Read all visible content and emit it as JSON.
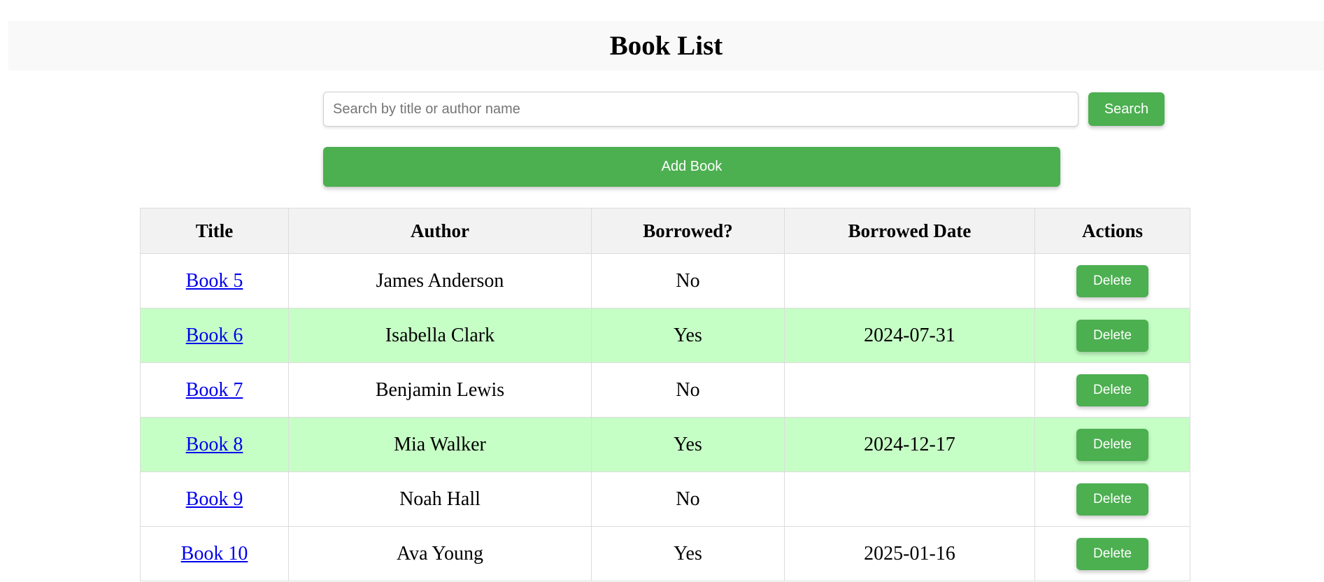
{
  "header": {
    "title": "Book List"
  },
  "search": {
    "placeholder": "Search by title or author name",
    "value": "",
    "button_label": "Search"
  },
  "actions": {
    "add_label": "Add Book"
  },
  "table": {
    "columns": [
      "Title",
      "Author",
      "Borrowed?",
      "Borrowed Date",
      "Actions"
    ],
    "delete_label": "Delete",
    "rows": [
      {
        "title": "Book 5",
        "author": "James Anderson",
        "borrowed": "No",
        "borrowed_date": ""
      },
      {
        "title": "Book 6",
        "author": "Isabella Clark",
        "borrowed": "Yes",
        "borrowed_date": "2024-07-31"
      },
      {
        "title": "Book 7",
        "author": "Benjamin Lewis",
        "borrowed": "No",
        "borrowed_date": ""
      },
      {
        "title": "Book 8",
        "author": "Mia Walker",
        "borrowed": "Yes",
        "borrowed_date": "2024-12-17"
      },
      {
        "title": "Book 9",
        "author": "Noah Hall",
        "borrowed": "No",
        "borrowed_date": ""
      },
      {
        "title": "Book 10",
        "author": "Ava Young",
        "borrowed": "Yes",
        "borrowed_date": "2025-01-16"
      }
    ]
  },
  "colors": {
    "accent": "#4caf50",
    "borrowed_row": "#c6ffc6",
    "header_bg": "#f9f9f9",
    "table_header_bg": "#f2f2f2",
    "link": "#0000ee"
  }
}
